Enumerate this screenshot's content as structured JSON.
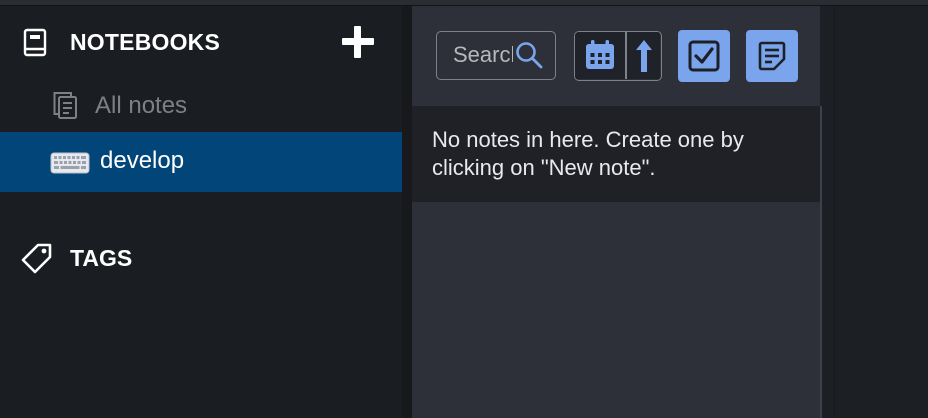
{
  "sidebar": {
    "notebooks_title": "NOTEBOOKS",
    "add_icon": "plus-icon",
    "items": [
      {
        "label": "All notes",
        "icon": "all-notes-icon",
        "selected": false
      },
      {
        "label": "develop",
        "icon": "keyboard-emoji-icon",
        "selected": true
      }
    ],
    "tags_title": "TAGS",
    "selected_color": "#024679"
  },
  "notelist": {
    "search": {
      "placeholder": "Search"
    },
    "buttons": [
      {
        "name": "sort-order-field",
        "icon": "calendar-icon"
      },
      {
        "name": "sort-direction",
        "icon": "arrow-up-icon"
      },
      {
        "name": "new-todo",
        "icon": "checkbox-icon"
      },
      {
        "name": "new-note",
        "icon": "note-icon"
      }
    ],
    "empty_message": "No notes in here. Create one by clicking on \"New note\".",
    "accent": "#7aa5ec"
  }
}
